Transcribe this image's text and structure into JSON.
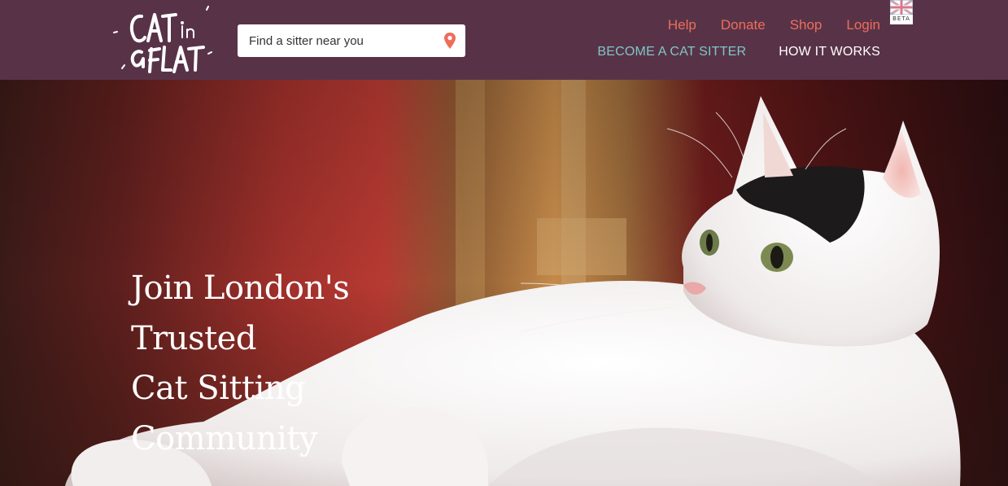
{
  "brand": {
    "logo_text": "CAT in a FLAT",
    "color": "#583348"
  },
  "search": {
    "placeholder": "Find a sitter near you",
    "icon": "map-pin-icon"
  },
  "top_links": {
    "help": "Help",
    "donate": "Donate",
    "shop": "Shop",
    "login": "Login"
  },
  "nav": {
    "become_sitter": "BECOME A CAT SITTER",
    "how_it_works": "HOW IT WORKS"
  },
  "beta_badge": {
    "label": "BETA",
    "flag": "uk-flag-icon"
  },
  "hero": {
    "headline_lines": [
      "Join London's",
      "Trusted",
      "Cat Sitting",
      "Community"
    ]
  },
  "colors": {
    "header_bg": "#583348",
    "link_accent": "#ee6d5a",
    "sitter_link": "#7fc6c8"
  }
}
